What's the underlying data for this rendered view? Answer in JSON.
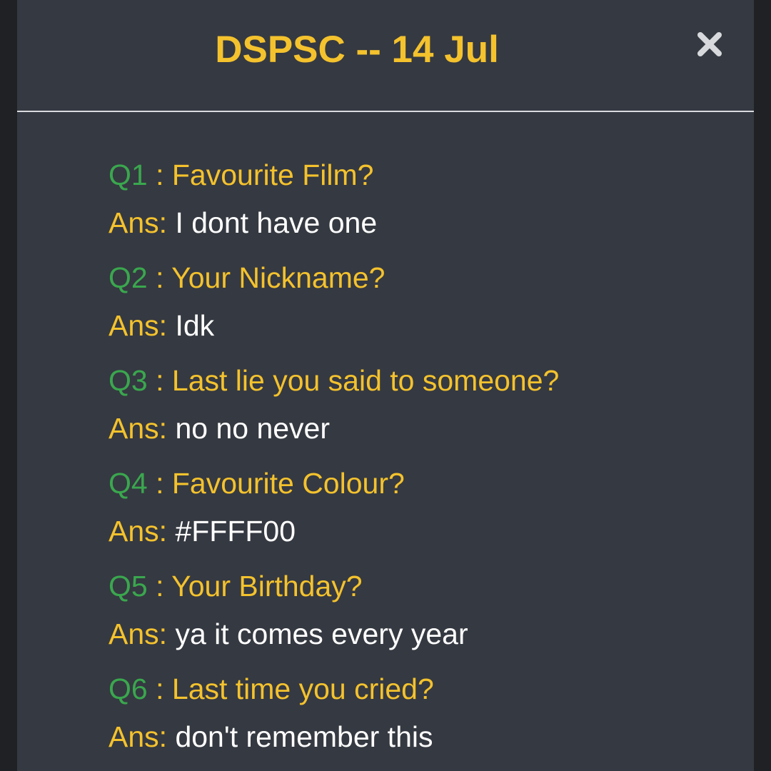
{
  "header": {
    "title": "DSPSC -- 14 Jul",
    "close_icon": "close-icon"
  },
  "colors": {
    "background": "#353941",
    "accent": "#f4c22d",
    "question_number": "#3aa74e",
    "answer_text": "#ffffff"
  },
  "answer_label": "Ans:",
  "items": [
    {
      "qnum": "Q1",
      "colon": " : ",
      "question": "Favourite Film?",
      "answer": "I dont have one"
    },
    {
      "qnum": "Q2",
      "colon": " : ",
      "question": "Your Nickname?",
      "answer": "Idk"
    },
    {
      "qnum": "Q3",
      "colon": " : ",
      "question": "Last lie you said to someone?",
      "answer": "no no never"
    },
    {
      "qnum": "Q4",
      "colon": " : ",
      "question": "Favourite Colour?",
      "answer": "#FFFF00"
    },
    {
      "qnum": "Q5",
      "colon": " : ",
      "question": "Your Birthday?",
      "answer": "ya it comes every year"
    },
    {
      "qnum": "Q6",
      "colon": " : ",
      "question": "Last time you cried?",
      "answer": "don't remember this"
    }
  ]
}
